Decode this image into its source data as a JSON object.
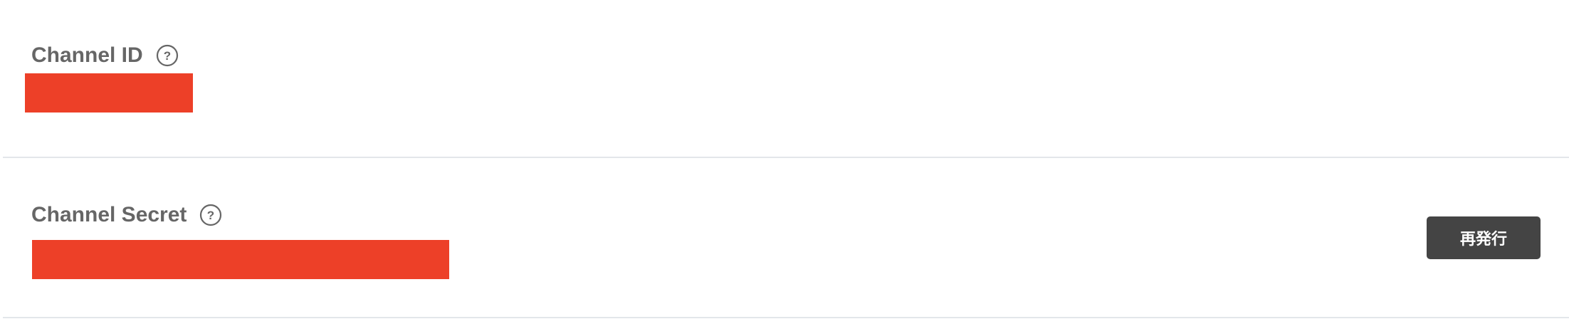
{
  "channel_id": {
    "label": "Channel ID",
    "help_icon": "question-circle-icon",
    "help_glyph": "?",
    "value_redacted": true,
    "redaction_color": "#ed4028"
  },
  "channel_secret": {
    "label": "Channel Secret",
    "help_icon": "question-circle-icon",
    "help_glyph": "?",
    "value_redacted": true,
    "redaction_color": "#ed4028",
    "reissue_button_label": "再発行"
  },
  "colors": {
    "label_text": "#666666",
    "button_background": "#444444",
    "button_text": "#ffffff",
    "divider": "#e3e6ea"
  }
}
